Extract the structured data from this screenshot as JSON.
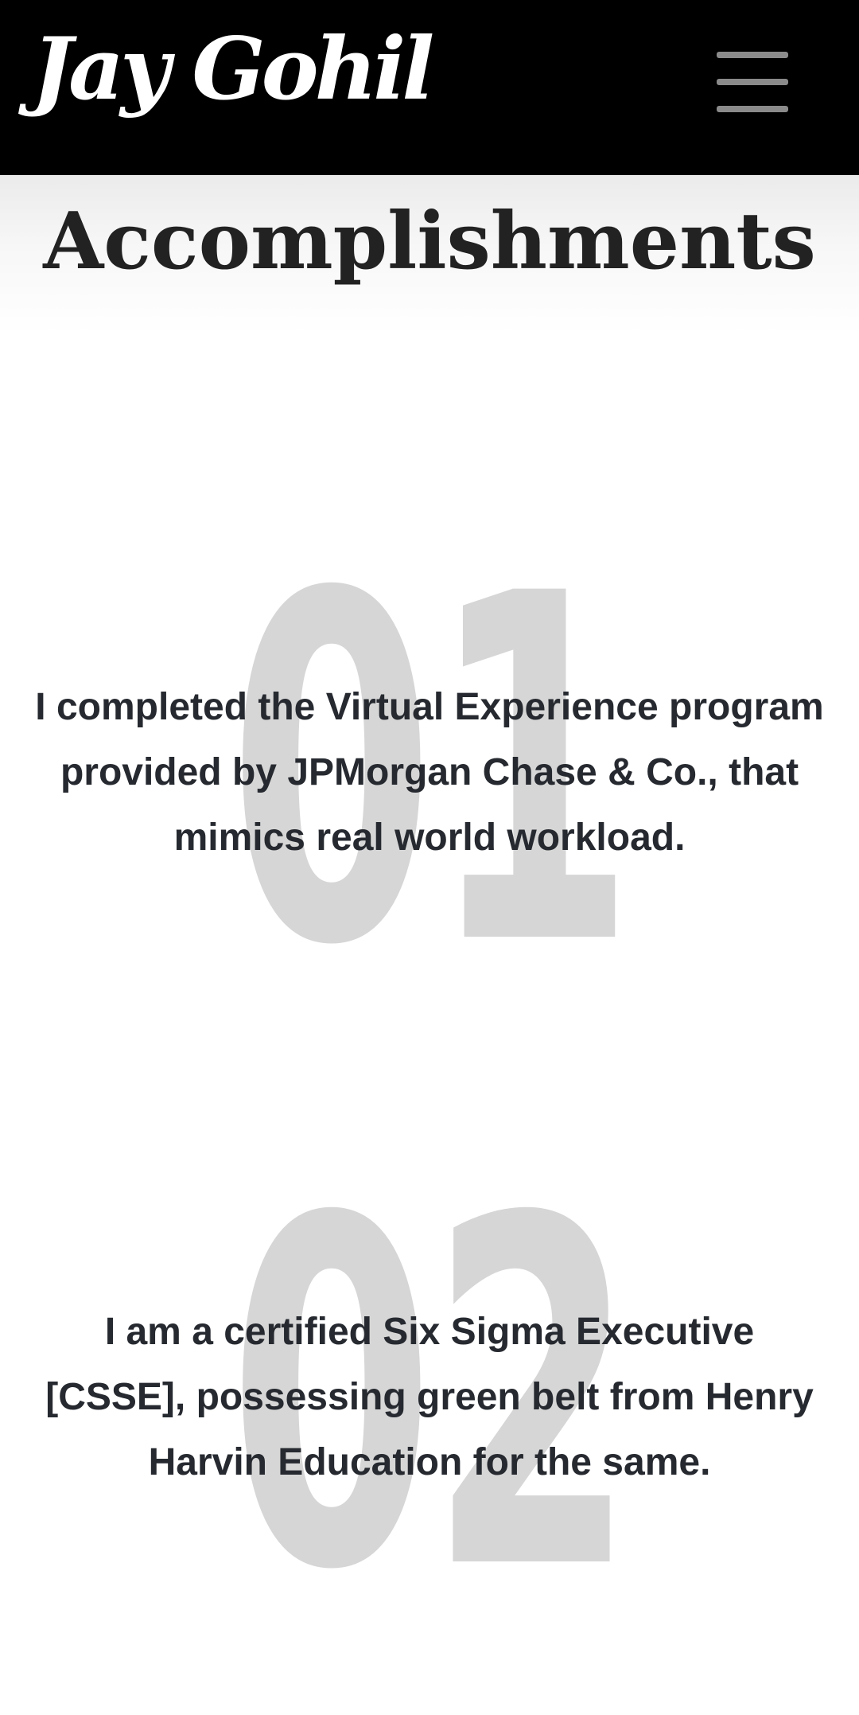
{
  "header": {
    "brand": "Jay Gohil",
    "menu_icon": "hamburger-menu-icon"
  },
  "page": {
    "title": "Accomplishments"
  },
  "accomplishments": [
    {
      "number": "01",
      "text": "I completed the Virtual Experience program provided by JPMorgan Chase & Co., that mimics real world workload."
    },
    {
      "number": "02",
      "text": "I am a certified Six Sigma Executive [CSSE], possessing green belt from Henry Harvin Education for the same."
    }
  ],
  "colors": {
    "navbar_background": "#000000",
    "brand_text": "#ffffff",
    "menu_icon": "#8a8a8a",
    "title_text": "#222222",
    "number_watermark": "#d6d6d6",
    "body_text": "#262a30"
  }
}
